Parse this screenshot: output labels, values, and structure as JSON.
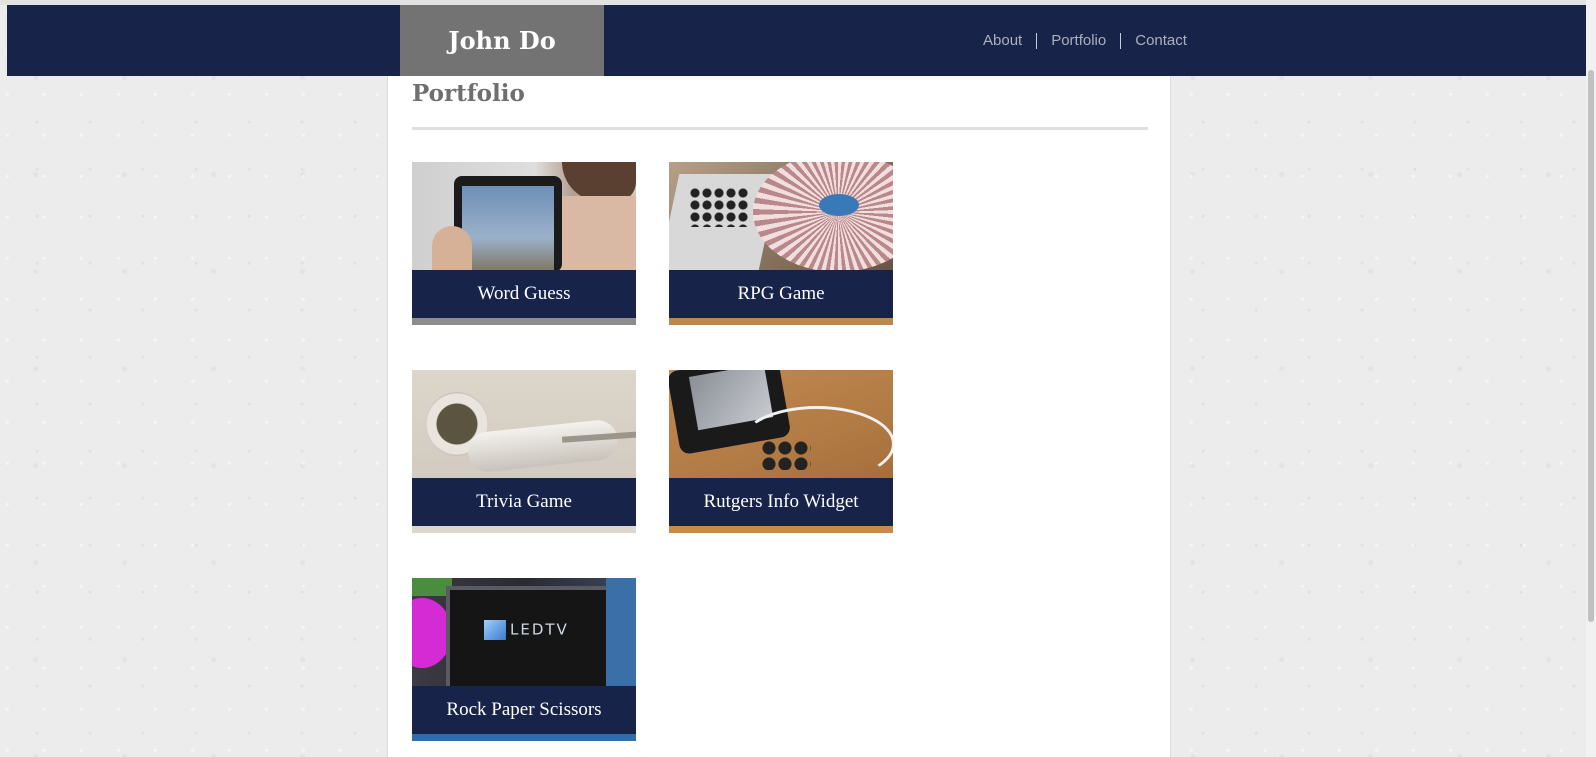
{
  "header": {
    "brand": "John Do",
    "nav": [
      {
        "label": "About"
      },
      {
        "label": "Portfolio"
      },
      {
        "label": "Contact"
      }
    ]
  },
  "main": {
    "title": "Portfolio",
    "projects": [
      {
        "caption": "Word Guess",
        "image": "tablet-photo"
      },
      {
        "caption": "RPG Game",
        "image": "dj-turntable-photo"
      },
      {
        "caption": "Trivia Game",
        "image": "earbuds-photo"
      },
      {
        "caption": "Rutgers Info Widget",
        "image": "smartphone-headphones-photo"
      },
      {
        "caption": "Rock Paper Scissors",
        "image": "led-tv-photo"
      }
    ],
    "led_tv_text": "LEDTV"
  },
  "colors": {
    "navbar": "#172349",
    "brand_bg": "#737373",
    "caption_bg": "#172349",
    "title": "#6f6f6f"
  }
}
